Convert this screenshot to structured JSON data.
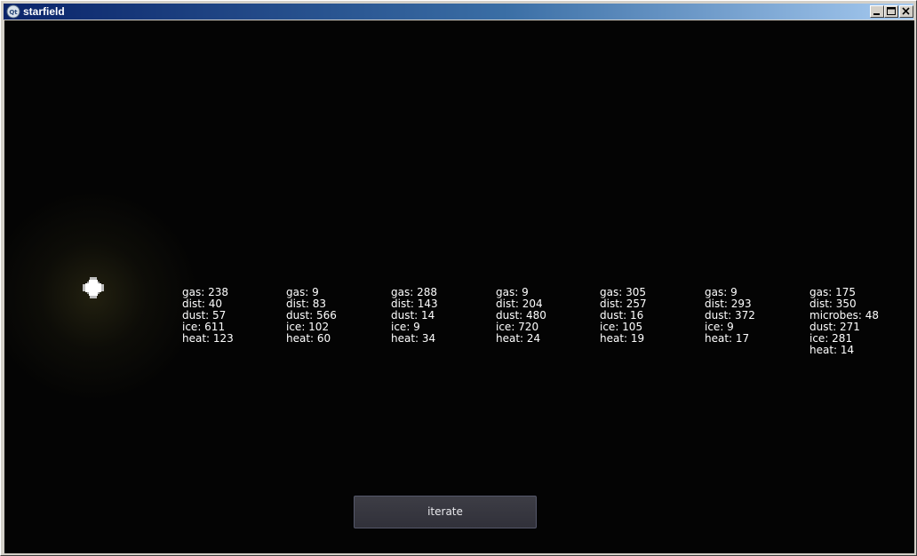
{
  "window": {
    "title": "starfield",
    "controls": {
      "minimize_icon": "minimize-icon",
      "maximize_icon": "maximize-icon",
      "close_icon": "close-icon"
    },
    "app_icon": "qt-logo-icon"
  },
  "scene": {
    "background_color": "#040404",
    "star_icon": "star-icon",
    "text_color": "#ffffff",
    "planets": [
      {
        "lines": [
          "gas: 238",
          "dist: 40",
          "dust: 57",
          "ice: 611",
          "heat: 123"
        ]
      },
      {
        "lines": [
          "gas: 9",
          "dist: 83",
          "dust: 566",
          "ice: 102",
          "heat: 60"
        ]
      },
      {
        "lines": [
          "gas: 288",
          "dist: 143",
          "dust: 14",
          "ice: 9",
          "heat: 34"
        ]
      },
      {
        "lines": [
          "gas: 9",
          "dist: 204",
          "dust: 480",
          "ice: 720",
          "heat: 24"
        ]
      },
      {
        "lines": [
          "gas: 305",
          "dist: 257",
          "dust: 16",
          "ice: 105",
          "heat: 19"
        ]
      },
      {
        "lines": [
          "gas: 9",
          "dist: 293",
          "dust: 372",
          "ice: 9",
          "heat: 17"
        ]
      },
      {
        "lines": [
          "gas: 175",
          "dist: 350",
          "microbes: 48",
          "dust: 271",
          "ice: 281",
          "heat: 14"
        ]
      }
    ]
  },
  "controls": {
    "iterate_label": "iterate"
  }
}
